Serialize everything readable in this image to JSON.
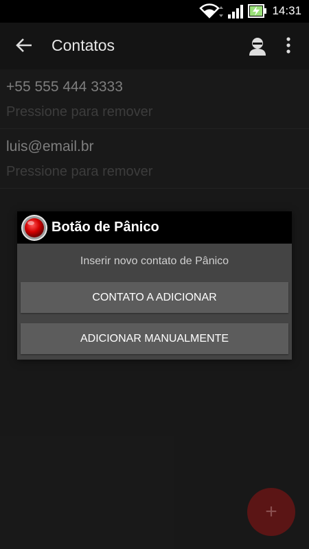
{
  "status_bar": {
    "time": "14:31"
  },
  "app_bar": {
    "title": "Contatos"
  },
  "contacts": [
    {
      "value": "+55 555 444 3333",
      "hint": "Pressione para remover"
    },
    {
      "value": "luis@email.br",
      "hint": "Pressione para remover"
    }
  ],
  "dialog": {
    "title": "Botão de Pânico",
    "message": "Inserir novo contato de Pânico",
    "button_contact": "CONTATO A ADICIONAR",
    "button_manual": "ADICIONAR MANUALMENTE"
  },
  "fab": {
    "label": "+"
  },
  "icons": {
    "back": "arrow-back-icon",
    "person": "person-icon",
    "more": "more-vert-icon",
    "wifi": "wifi-icon",
    "signal": "cell-signal-icon",
    "battery": "battery-charging-icon",
    "logo": "panic-button-logo",
    "add": "add-icon"
  },
  "colors": {
    "accent": "#5b1515",
    "dialog_bg": "#444444",
    "button_bg": "#5c5c5c"
  }
}
